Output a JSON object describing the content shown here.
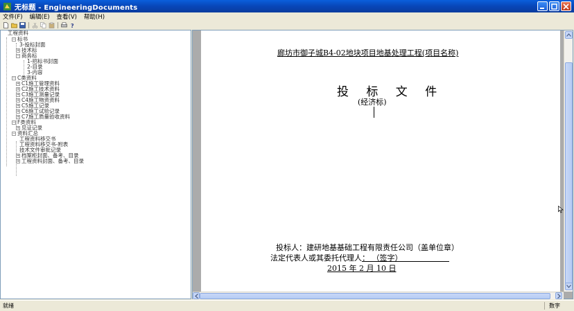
{
  "window": {
    "title": "无标题 - EngineeringDocuments"
  },
  "menu": [
    {
      "label": "文件(F)"
    },
    {
      "label": "编辑(E)"
    },
    {
      "label": "查看(V)"
    },
    {
      "label": "帮助(H)"
    }
  ],
  "tree": {
    "root": "工程资料",
    "items": [
      "标书",
      "3-投标封面",
      "技术标",
      "商务标",
      "1-招标书封面",
      "2-目录",
      "3-内容",
      "C类资料",
      "C1施工管理资料",
      "C2施工技术资料",
      "C3施工测量记录",
      "C4施工物资资料",
      "C5施工记录",
      "C6施工试验记录",
      "C7施工质量验收资料",
      "F类资料",
      "见证记录",
      "资料汇总",
      "工程资料移交书",
      "工程资料移交书-附表",
      "技术文件审批记录",
      "档案柜封面、备考、目录",
      "工程资料封面、备考、目录"
    ]
  },
  "document": {
    "project_title": "廊坊市御子城B4-02地块项目地基处理工程(项目名称)",
    "main_title": "投 标 文 件",
    "sub_title": "(经济标)",
    "bidder_line": "投标人：建研地基基础工程有限责任公司（盖单位章）",
    "representative_line": "法定代表人或其委托代理人：                            （签字）",
    "date_line": "2015  年  2  月  10  日"
  },
  "status": {
    "left": "就绪",
    "right": "数字"
  }
}
